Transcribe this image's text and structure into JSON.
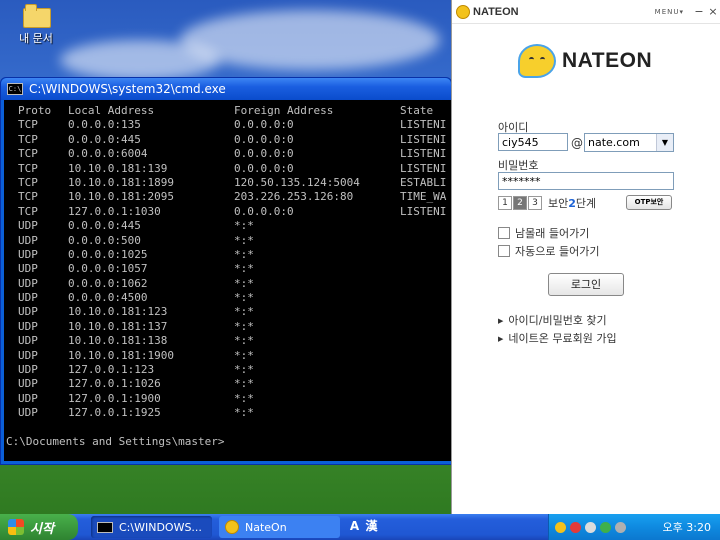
{
  "desktop": {
    "icon_label": "내 문서"
  },
  "cmd": {
    "title": "C:\\WINDOWS\\system32\\cmd.exe",
    "header": [
      "Proto",
      "Local Address",
      "Foreign Address",
      "State"
    ],
    "rows": [
      [
        "TCP",
        "0.0.0.0:135",
        "0.0.0.0:0",
        "LISTENI"
      ],
      [
        "TCP",
        "0.0.0.0:445",
        "0.0.0.0:0",
        "LISTENI"
      ],
      [
        "TCP",
        "0.0.0.0:6004",
        "0.0.0.0:0",
        "LISTENI"
      ],
      [
        "TCP",
        "10.10.0.181:139",
        "0.0.0.0:0",
        "LISTENI"
      ],
      [
        "TCP",
        "10.10.0.181:1899",
        "120.50.135.124:5004",
        "ESTABLI"
      ],
      [
        "TCP",
        "10.10.0.181:2095",
        "203.226.253.126:80",
        "TIME_WA"
      ],
      [
        "TCP",
        "127.0.0.1:1030",
        "0.0.0.0:0",
        "LISTENI"
      ],
      [
        "UDP",
        "0.0.0.0:445",
        "*:*",
        ""
      ],
      [
        "UDP",
        "0.0.0.0:500",
        "*:*",
        ""
      ],
      [
        "UDP",
        "0.0.0.0:1025",
        "*:*",
        ""
      ],
      [
        "UDP",
        "0.0.0.0:1057",
        "*:*",
        ""
      ],
      [
        "UDP",
        "0.0.0.0:1062",
        "*:*",
        ""
      ],
      [
        "UDP",
        "0.0.0.0:4500",
        "*:*",
        ""
      ],
      [
        "UDP",
        "10.10.0.181:123",
        "*:*",
        ""
      ],
      [
        "UDP",
        "10.10.0.181:137",
        "*:*",
        ""
      ],
      [
        "UDP",
        "10.10.0.181:138",
        "*:*",
        ""
      ],
      [
        "UDP",
        "10.10.0.181:1900",
        "*:*",
        ""
      ],
      [
        "UDP",
        "127.0.0.1:123",
        "*:*",
        ""
      ],
      [
        "UDP",
        "127.0.0.1:1026",
        "*:*",
        ""
      ],
      [
        "UDP",
        "127.0.0.1:1900",
        "*:*",
        ""
      ],
      [
        "UDP",
        "127.0.0.1:1925",
        "*:*",
        ""
      ]
    ],
    "prompt": "C:\\Documents and Settings\\master>"
  },
  "nateon": {
    "brand": "NATEON",
    "menu_label": "MENU▾",
    "minimize": "−",
    "close": "×",
    "logo_text": "NATEON",
    "id_label": "아이디",
    "id_value": "ciy545",
    "at": "@",
    "domain_value": "nate.com",
    "password_label": "비밀번호",
    "password_value": "*******",
    "security_levels": [
      "1",
      "2",
      "3"
    ],
    "security_text_prefix": "보안",
    "security_level_number": "2",
    "security_text_suffix": "단계",
    "otp_label": "OTP보안",
    "checkbox_stealth": "남몰래 들어가기",
    "checkbox_auto": "자동으로 들어가기",
    "login_label": "로그인",
    "link_find": "아이디/비밀번호 찾기",
    "link_join": "네이트온 무료회원 가입"
  },
  "taskbar": {
    "start_label": "시작",
    "task_cmd": "C:\\WINDOWS...",
    "task_nate": "NateOn",
    "ime_a": "A",
    "ime_han": "漢",
    "clock": "오후 3:20"
  },
  "colors": {
    "accent": "#1d63d6",
    "taskbar": "#245edb",
    "start": "#3c9a3e"
  }
}
